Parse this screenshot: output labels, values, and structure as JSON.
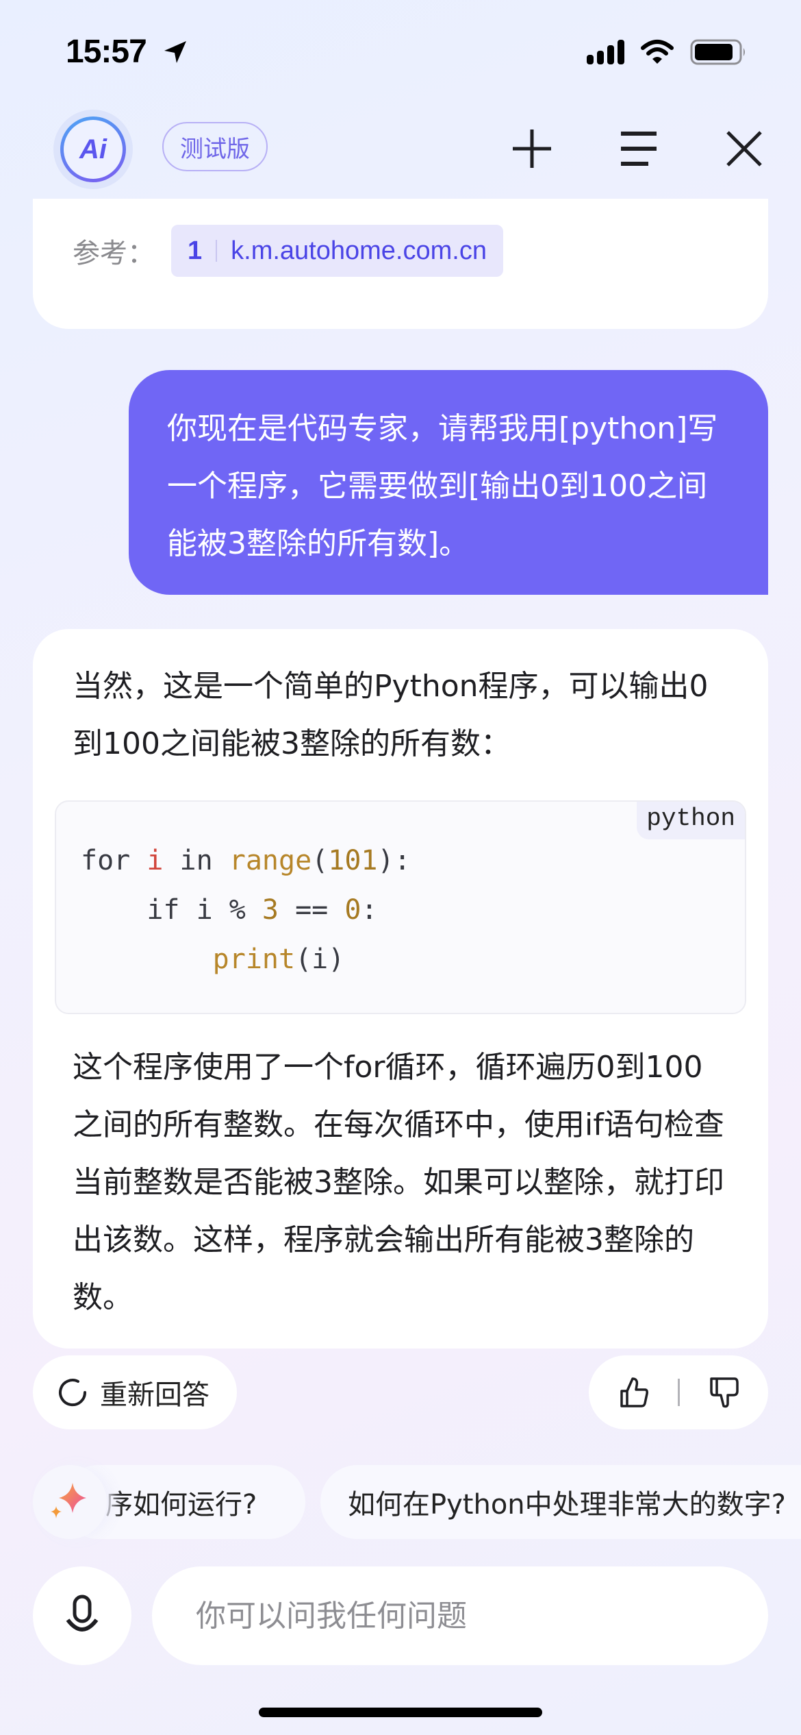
{
  "status_bar": {
    "time": "15:57",
    "icons": [
      "location-arrow-icon",
      "cellular-signal-icon",
      "wifi-icon",
      "battery-icon"
    ]
  },
  "header": {
    "logo_text": "Ai",
    "badge": "测试版",
    "buttons": [
      {
        "name": "new-chat",
        "icon": "plus-icon"
      },
      {
        "name": "history",
        "icon": "menu-icon"
      },
      {
        "name": "close",
        "icon": "close-icon"
      }
    ]
  },
  "previous_answer": {
    "reference_label": "参考：",
    "references": [
      {
        "index": "1",
        "source": "k.m.autohome.com.cn"
      }
    ]
  },
  "user_message": {
    "text": "你现在是代码专家，请帮我用[python]写一个程序，它需要做到[输出0到100之间能被3整除的所有数]。"
  },
  "assistant_message": {
    "intro": "当然，这是一个简单的Python程序，可以输出0到100之间能被3整除的所有数：",
    "code": {
      "language": "python",
      "lines": [
        [
          {
            "t": "for ",
            "c": ""
          },
          {
            "t": "i",
            "c": "var"
          },
          {
            "t": " in ",
            "c": ""
          },
          {
            "t": "range",
            "c": "fn"
          },
          {
            "t": "(",
            "c": ""
          },
          {
            "t": "101",
            "c": "num"
          },
          {
            "t": "):",
            "c": ""
          }
        ],
        [
          {
            "t": "    if i % ",
            "c": ""
          },
          {
            "t": "3",
            "c": "num"
          },
          {
            "t": " == ",
            "c": ""
          },
          {
            "t": "0",
            "c": "num"
          },
          {
            "t": ":",
            "c": ""
          }
        ],
        [
          {
            "t": "        ",
            "c": ""
          },
          {
            "t": "print",
            "c": "fn"
          },
          {
            "t": "(i)",
            "c": ""
          }
        ]
      ]
    },
    "explanation": "这个程序使用了一个for循环，循环遍历0到100之间的所有整数。在每次循环中，使用if语句检查当前整数是否能被3整除。如果可以整除，就打印出该数。这样，程序就会输出所有能被3整除的数。"
  },
  "actions": {
    "regenerate": "重新回答",
    "like_icon": "thumbs-up-icon",
    "dislike_icon": "thumbs-down-icon"
  },
  "suggestions": [
    "序如何运行?",
    "如何在Python中处理非常大的数字?"
  ],
  "input": {
    "placeholder": "你可以问我任何问题",
    "value": ""
  },
  "colors": {
    "accent": "#7066f5",
    "link": "#4a44e6",
    "ref_chip_bg": "#e8e7fc",
    "code_keyword_var": "#d1453b",
    "code_function": "#b7862a"
  }
}
